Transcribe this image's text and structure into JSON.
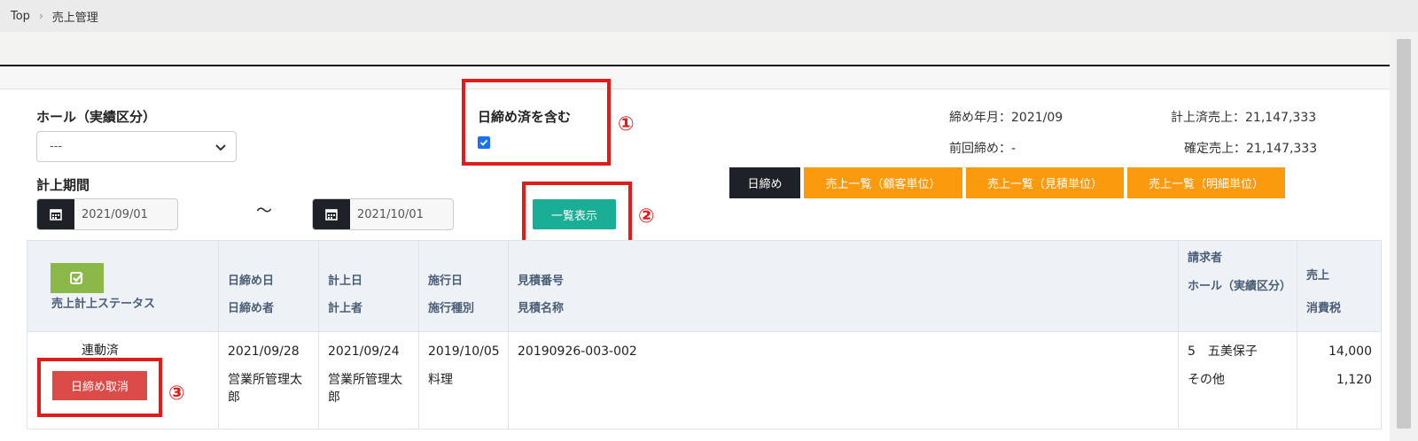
{
  "breadcrumb": {
    "home": "Top",
    "separator": "›",
    "current": "売上管理"
  },
  "filters": {
    "hall_label": "ホール（実績区分）",
    "hall_value": "---",
    "period_label": "計上期間",
    "date_from": "2021/09/01",
    "date_to": "2021/10/01",
    "tilde": "～",
    "include_closed_label": "日締め済を含む",
    "include_closed_checked": true
  },
  "actions": {
    "list_button": "一覧表示"
  },
  "summary": {
    "closing_month": "締め年月：2021/09",
    "previous_closing": "前回締め：-",
    "recorded_sales": "計上済売上：21,147,333",
    "confirmed_sales": "確定売上：21,147,333"
  },
  "tabs": [
    "日締め",
    "売上一覧（顧客単位）",
    "売上一覧（見積単位）",
    "売上一覧（明細単位）"
  ],
  "table": {
    "headers": {
      "status": "売上計上ステータス",
      "close_date": "日締め日",
      "close_user": "日締め者",
      "record_date": "計上日",
      "record_user": "計上者",
      "exec_date": "施行日",
      "exec_type": "施行種別",
      "estimate_no": "見積番号",
      "estimate_name": "見積名称",
      "requester": "請求者",
      "hall": "ホール（実績区分）",
      "sales": "売上",
      "tax": "消費税"
    },
    "rows": [
      {
        "status": "連動済",
        "cancel_button": "日締め取消",
        "close_date": "2021/09/28",
        "close_user": "営業所管理太郎",
        "record_date": "2021/09/24",
        "record_user": "営業所管理太郎",
        "exec_date": "2019/10/05",
        "exec_type": "料理",
        "estimate_no": "20190926-003-002",
        "estimate_name": "",
        "requester": "5　五美保子",
        "hall": "その他",
        "sales": "14,000",
        "tax": "1,120"
      }
    ]
  },
  "annotations": {
    "m1": "①",
    "m2": "②",
    "m3": "③"
  },
  "colors": {
    "teal": "#1aae96",
    "orange": "#fb9a0c",
    "dark": "#1e2127",
    "red_annotation": "#e21a1a",
    "cancel_red": "#dd4b49",
    "status_green": "#8ab94a"
  },
  "icons": [
    "chevron-right-icon",
    "chevron-down-icon",
    "calendar-icon",
    "checkbox-icon",
    "check-square-icon"
  ]
}
